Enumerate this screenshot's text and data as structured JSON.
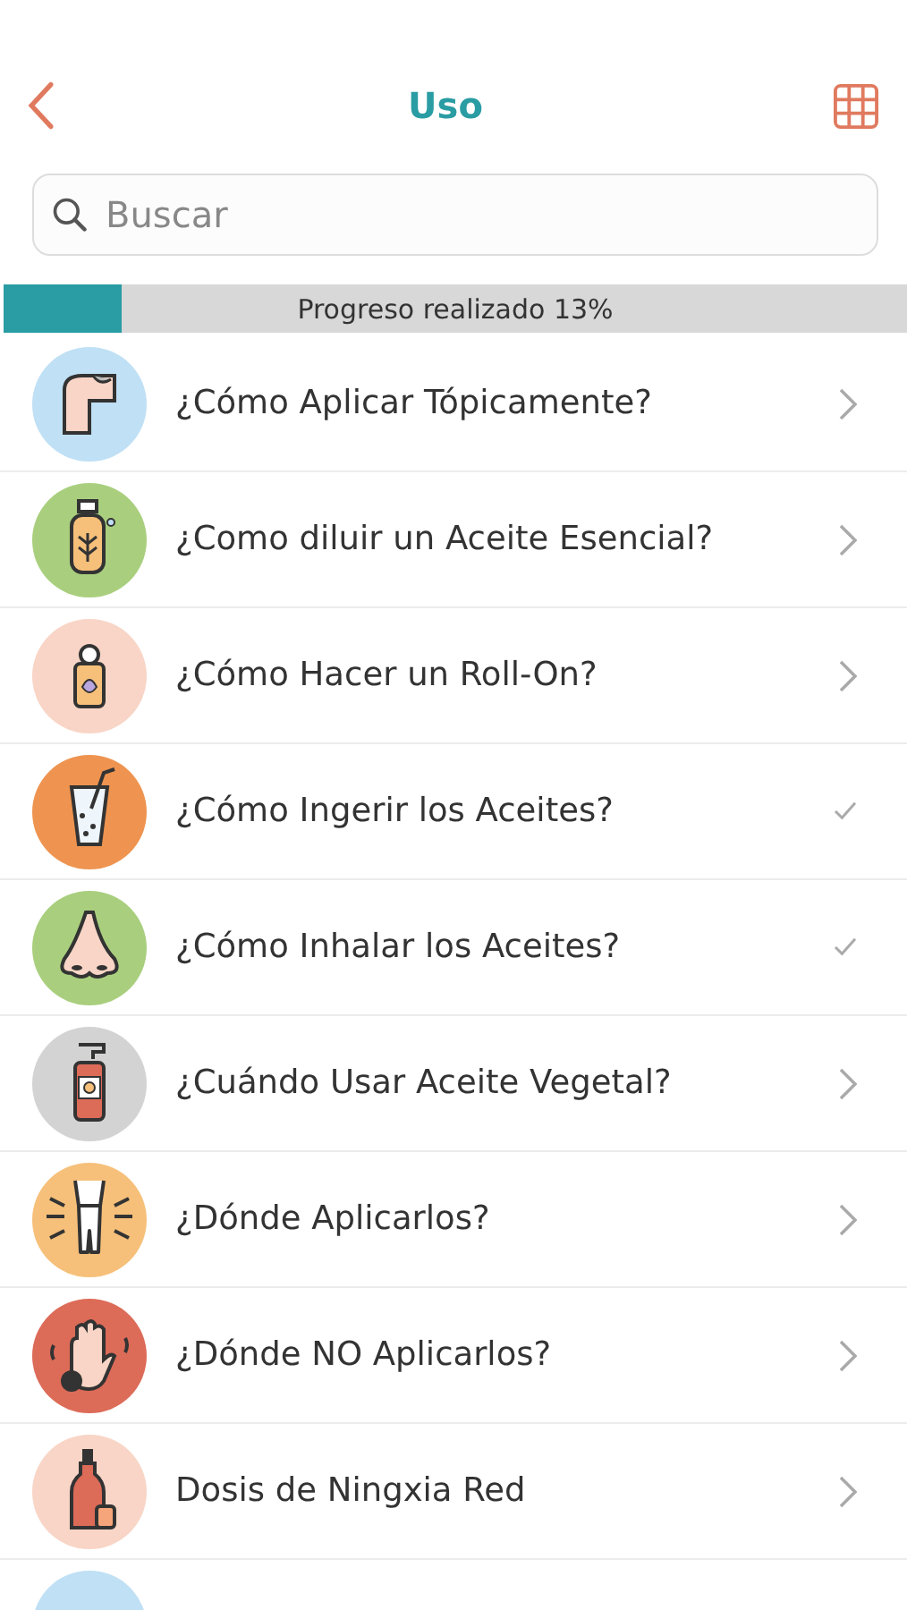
{
  "header": {
    "title": "Uso"
  },
  "search": {
    "placeholder": "Buscar"
  },
  "progress": {
    "label": "Progreso realizado 13%",
    "level": 0.13
  },
  "items": [
    {
      "title": "¿Cómo Aplicar Tópicamente?",
      "done": false,
      "color": "#bfe0f5"
    },
    {
      "title": "¿Como diluir un Aceite Esencial?",
      "done": false,
      "color": "#a9cf7e"
    },
    {
      "title": "¿Cómo Hacer un Roll-On?",
      "done": false,
      "color": "#f8d5c6"
    },
    {
      "title": "¿Cómo Ingerir los Aceites?",
      "done": true,
      "color": "#ee9450"
    },
    {
      "title": "¿Cómo Inhalar los Aceites?",
      "done": true,
      "color": "#a9cf7e"
    },
    {
      "title": "¿Cuándo Usar Aceite Vegetal?",
      "done": false,
      "color": "#d3d3d3"
    },
    {
      "title": "¿Dónde Aplicarlos?",
      "done": false,
      "color": "#f6c07a"
    },
    {
      "title": "¿Dónde NO Aplicarlos?",
      "done": false,
      "color": "#dc6b58"
    },
    {
      "title": "Dosis de Ningxia Red",
      "done": false,
      "color": "#f8d5c6"
    },
    {
      "color": "#bfe0f5"
    }
  ]
}
